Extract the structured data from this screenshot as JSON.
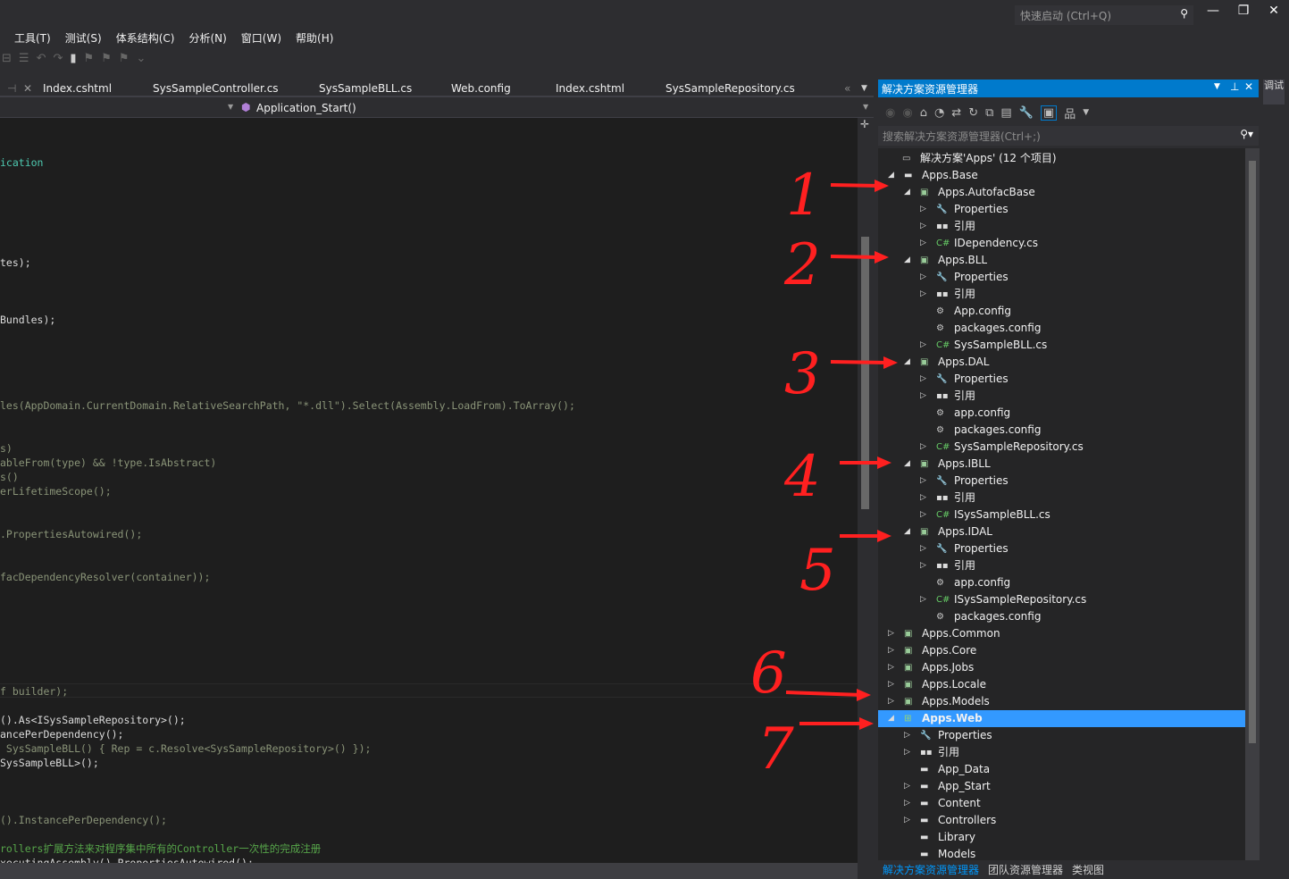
{
  "titlebar": {
    "quick_launch_placeholder": "快速启动 (Ctrl+Q)",
    "search_icon": "search-icon",
    "minimize": "—",
    "restore": "❐",
    "close": "✕"
  },
  "menu": [
    "工具(T)",
    "测试(S)",
    "体系结构(C)",
    "分析(N)",
    "窗口(W)",
    "帮助(H)"
  ],
  "editor_tabs": [
    "Index.cshtml",
    "SysSampleController.cs",
    "SysSampleBLL.cs",
    "Web.config",
    "Index.cshtml",
    "SysSampleRepository.cs"
  ],
  "navbar": {
    "member": "Application_Start()"
  },
  "code_lines": [
    {
      "text": "ication",
      "color": "teal"
    },
    {
      "text": "tes);",
      "color": "white"
    },
    {
      "text": "Bundles);",
      "color": "white"
    },
    {
      "text": "les(AppDomain.CurrentDomain.RelativeSearchPath, \"*.dll\").Select(Assembly.LoadFrom).ToArray();",
      "color": "dim"
    },
    {
      "text": "s)",
      "color": "dim"
    },
    {
      "text": "ableFrom(type) && !type.IsAbstract)",
      "color": "dim"
    },
    {
      "text": "s()",
      "color": "dim"
    },
    {
      "text": "erLifetimeScope();",
      "color": "dim"
    },
    {
      "text": ".PropertiesAutowired();",
      "color": "dim"
    },
    {
      "text": "facDependencyResolver(container));",
      "color": "dim"
    },
    {
      "text": "f builder);",
      "color": "dim"
    },
    {
      "text": "().As<ISysSampleRepository>();",
      "color": "white"
    },
    {
      "text": "ancePerDependency();",
      "color": "white"
    },
    {
      "text": " SysSampleBLL() { Rep = c.Resolve<SysSampleRepository>() });",
      "color": "dim"
    },
    {
      "text": "SysSampleBLL>();",
      "color": "white"
    },
    {
      "text": "().InstancePerDependency();",
      "color": "dim"
    },
    {
      "text": "rollers扩展方法来对程序集中所有的Controller一次性的完成注册",
      "color": "green"
    },
    {
      "text": "xecutingAssembly().PropertiesAutowired();",
      "color": "white"
    }
  ],
  "solution_explorer": {
    "title": "解决方案资源管理器",
    "search_placeholder": "搜索解决方案资源管理器(Ctrl+;)",
    "tree": [
      {
        "label": "解决方案'Apps' (12 个项目)",
        "level": -1,
        "expand": "",
        "icon": "solution"
      },
      {
        "label": "Apps.Base",
        "level": 0,
        "expand": "open",
        "icon": "folder"
      },
      {
        "label": "Apps.AutofacBase",
        "level": 1,
        "expand": "open",
        "icon": "csproj"
      },
      {
        "label": "Properties",
        "level": 2,
        "expand": "closed",
        "icon": "wrench"
      },
      {
        "label": "引用",
        "level": 2,
        "expand": "closed",
        "icon": "references"
      },
      {
        "label": "IDependency.cs",
        "level": 2,
        "expand": "closed",
        "icon": "csfile"
      },
      {
        "label": "Apps.BLL",
        "level": 1,
        "expand": "open",
        "icon": "csproj"
      },
      {
        "label": "Properties",
        "level": 2,
        "expand": "closed",
        "icon": "wrench"
      },
      {
        "label": "引用",
        "level": 2,
        "expand": "closed",
        "icon": "references"
      },
      {
        "label": "App.config",
        "level": 2,
        "expand": "",
        "icon": "config"
      },
      {
        "label": "packages.config",
        "level": 2,
        "expand": "",
        "icon": "config"
      },
      {
        "label": "SysSampleBLL.cs",
        "level": 2,
        "expand": "closed",
        "icon": "csfile"
      },
      {
        "label": "Apps.DAL",
        "level": 1,
        "expand": "open",
        "icon": "csproj"
      },
      {
        "label": "Properties",
        "level": 2,
        "expand": "closed",
        "icon": "wrench"
      },
      {
        "label": "引用",
        "level": 2,
        "expand": "closed",
        "icon": "references"
      },
      {
        "label": "app.config",
        "level": 2,
        "expand": "",
        "icon": "config"
      },
      {
        "label": "packages.config",
        "level": 2,
        "expand": "",
        "icon": "config"
      },
      {
        "label": "SysSampleRepository.cs",
        "level": 2,
        "expand": "closed",
        "icon": "csfile"
      },
      {
        "label": "Apps.IBLL",
        "level": 1,
        "expand": "open",
        "icon": "csproj"
      },
      {
        "label": "Properties",
        "level": 2,
        "expand": "closed",
        "icon": "wrench"
      },
      {
        "label": "引用",
        "level": 2,
        "expand": "closed",
        "icon": "references"
      },
      {
        "label": "ISysSampleBLL.cs",
        "level": 2,
        "expand": "closed",
        "icon": "csfile"
      },
      {
        "label": "Apps.IDAL",
        "level": 1,
        "expand": "open",
        "icon": "csproj"
      },
      {
        "label": "Properties",
        "level": 2,
        "expand": "closed",
        "icon": "wrench"
      },
      {
        "label": "引用",
        "level": 2,
        "expand": "closed",
        "icon": "references"
      },
      {
        "label": "app.config",
        "level": 2,
        "expand": "",
        "icon": "config"
      },
      {
        "label": "ISysSampleRepository.cs",
        "level": 2,
        "expand": "closed",
        "icon": "csfile"
      },
      {
        "label": "packages.config",
        "level": 2,
        "expand": "",
        "icon": "config"
      },
      {
        "label": "Apps.Common",
        "level": 0,
        "expand": "closed",
        "icon": "csproj"
      },
      {
        "label": "Apps.Core",
        "level": 0,
        "expand": "closed",
        "icon": "csproj"
      },
      {
        "label": "Apps.Jobs",
        "level": 0,
        "expand": "closed",
        "icon": "csproj"
      },
      {
        "label": "Apps.Locale",
        "level": 0,
        "expand": "closed",
        "icon": "csproj"
      },
      {
        "label": "Apps.Models",
        "level": 0,
        "expand": "closed",
        "icon": "csproj"
      },
      {
        "label": "Apps.Web",
        "level": 0,
        "expand": "open",
        "icon": "webproj",
        "selected": true
      },
      {
        "label": "Properties",
        "level": 1,
        "expand": "closed",
        "icon": "wrench"
      },
      {
        "label": "引用",
        "level": 1,
        "expand": "closed",
        "icon": "references"
      },
      {
        "label": "App_Data",
        "level": 1,
        "expand": "",
        "icon": "folder"
      },
      {
        "label": "App_Start",
        "level": 1,
        "expand": "closed",
        "icon": "folder"
      },
      {
        "label": "Content",
        "level": 1,
        "expand": "closed",
        "icon": "folder"
      },
      {
        "label": "Controllers",
        "level": 1,
        "expand": "closed",
        "icon": "folder"
      },
      {
        "label": "Library",
        "level": 1,
        "expand": "",
        "icon": "folder"
      },
      {
        "label": "Models",
        "level": 1,
        "expand": "",
        "icon": "folder"
      }
    ],
    "bottom_tabs": [
      "解决方案资源管理器",
      "团队资源管理器",
      "类视图"
    ]
  },
  "side_tab": "调试",
  "annotations": [
    "1",
    "2",
    "3",
    "4",
    "5",
    "6",
    "7"
  ],
  "annotation_color": "#ff2020",
  "selection_color": "#3399ff",
  "accent_color": "#007acc"
}
